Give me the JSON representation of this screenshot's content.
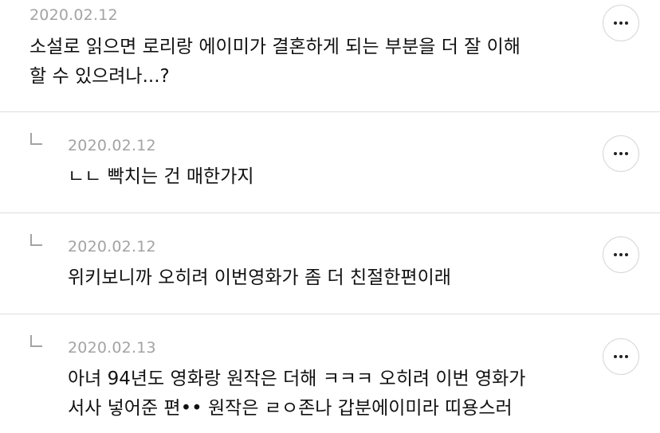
{
  "comments": [
    {
      "date": "2020.02.12",
      "lines": [
        "소설로 읽으면 로리랑 에이미가 결혼하게 되는 부분을 더 잘 이해",
        "할 수 있으려나...?"
      ],
      "reply": false
    },
    {
      "date": "2020.02.12",
      "lines": [
        "ㄴㄴ 빡치는 건 매한가지"
      ],
      "reply": true
    },
    {
      "date": "2020.02.12",
      "lines": [
        "위키보니까 오히려 이번영화가 좀 더 친절한편이래"
      ],
      "reply": true
    },
    {
      "date": "2020.02.13",
      "lines": [
        "아녀 94년도 영화랑 원작은 더해 ㅋㅋㅋ 오히려 이번 영화가",
        "서사 넣어준 편•• 원작은 ㄹㅇ존나 갑분에이미라 띠용스러"
      ],
      "reply": true
    }
  ],
  "icons": {
    "more": "more-horizontal-icon",
    "reply": "reply-arrow-icon"
  },
  "colors": {
    "date": "#a3a3a3",
    "text": "#111111",
    "divider": "#dddddd",
    "button_border": "#d6d6d6"
  }
}
